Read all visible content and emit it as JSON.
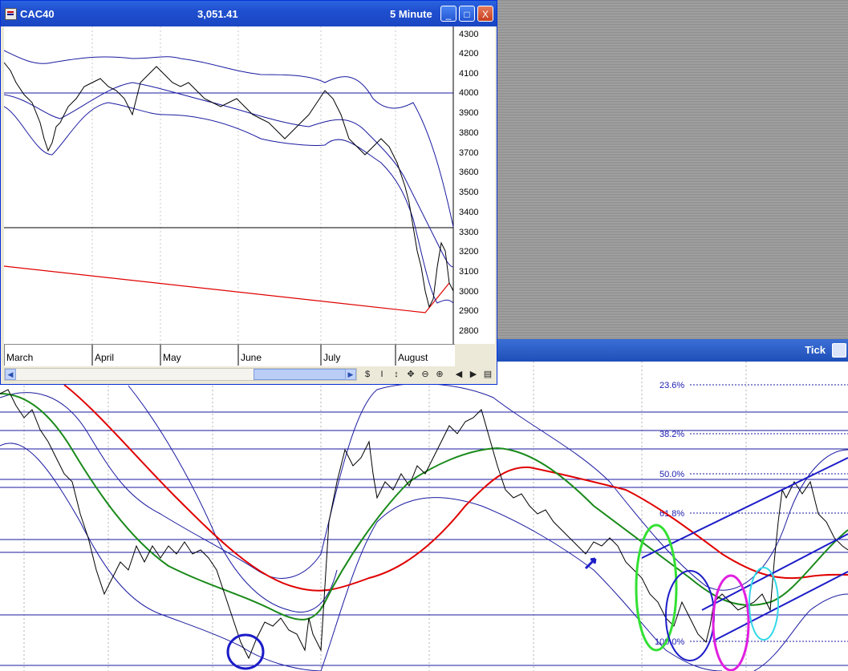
{
  "window": {
    "symbol": "CAC40",
    "price": "3,051.41",
    "period": "5 Minute",
    "buttons": {
      "minimize": "_",
      "maximize": "□",
      "close": "X"
    }
  },
  "small_chart": {
    "y_ticks": [
      "4300",
      "4200",
      "4100",
      "4000",
      "3900",
      "3800",
      "3700",
      "3600",
      "3500",
      "3400",
      "3300",
      "3200",
      "3100",
      "3000",
      "2900",
      "2800"
    ],
    "months": [
      "March",
      "April",
      "May",
      "June",
      "July",
      "August"
    ]
  },
  "toolbar_icons": [
    "scroll-left-icon",
    "scroll-right-icon",
    "hand-icon",
    "cursor-icon",
    "crosshair-icon",
    "zoom-out-icon",
    "zoom-in-icon",
    "play-back-icon",
    "play-forward-icon",
    "panel-icon"
  ],
  "toolbar_glyphs": [
    "$",
    "I",
    "↕",
    "✥",
    "⊖",
    "⊕",
    "◀",
    "▶",
    "▤"
  ],
  "background_window": {
    "title": "Tick"
  },
  "fib_levels": [
    "23.6%",
    "38.2%",
    "50.0%",
    "61.8%",
    "100.0%"
  ],
  "colors": {
    "price": "#000000",
    "bands": "#1a1aa0",
    "ma_short": "#1a8a1a",
    "ma_long": "#e00000",
    "fib_line": "#1a1aa0",
    "circle_blue": "#1c1cc8",
    "circle_green": "#33e033",
    "circle_magenta": "#e020e0",
    "circle_cyan": "#33d8e8"
  }
}
